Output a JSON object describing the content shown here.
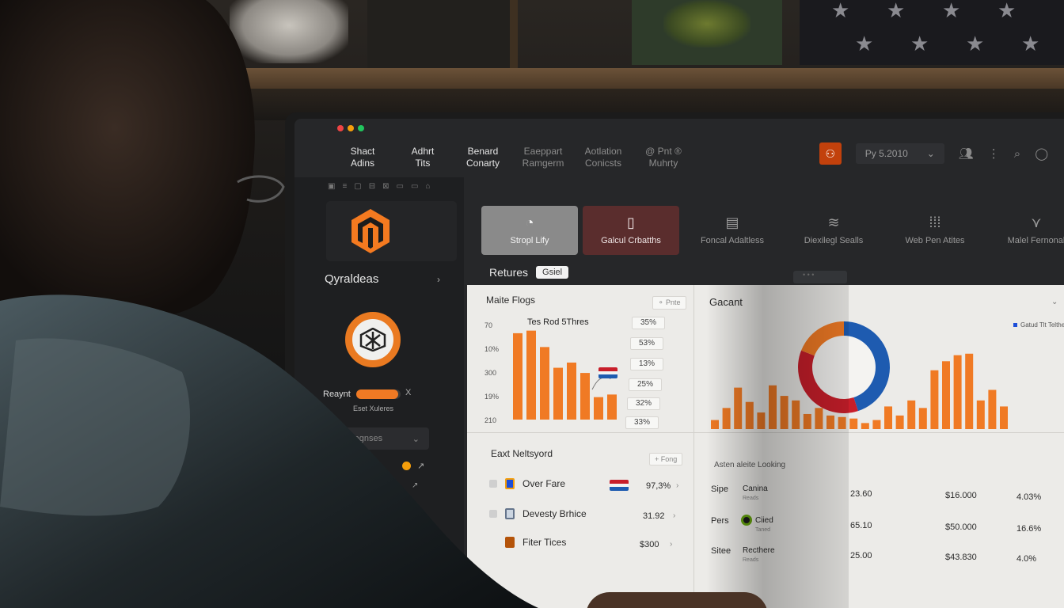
{
  "window": {
    "dots": [
      "#ef4444",
      "#f59e0b",
      "#22c55e"
    ]
  },
  "top_menu": [
    {
      "line1": "Shact",
      "line2": "Adins"
    },
    {
      "line1": "Adhrt",
      "line2": "Tits"
    },
    {
      "line1": "Benard",
      "line2": "Conarty"
    },
    {
      "line1": "Eaeppart",
      "line2": "Ramgerm"
    },
    {
      "line1": "Aotlation",
      "line2": "Conicsts"
    },
    {
      "line1": "@ Pnt ®",
      "line2": "Muhrty"
    }
  ],
  "top_right": {
    "select_text": "Py 5.2010",
    "select_chevron": "⌄"
  },
  "sidebar": {
    "heading": "Qyraldeas",
    "chevron": "›",
    "progress_label": "Reaynt",
    "progress_value": 0.95,
    "progress_x": "X",
    "progress_sub": "Eset Xuleres",
    "dropdown": "Oaster Viagnses",
    "dropdown_chevron": "⌄",
    "mini_arrow": "↗",
    "mini_arrow2": "↗"
  },
  "tabs": [
    {
      "icon": "◔",
      "label": "Stropl Lify"
    },
    {
      "icon": "▯",
      "label": "Galcul Crbatths"
    },
    {
      "icon": "▤",
      "label": "Foncal Adaltless"
    },
    {
      "icon": "≋",
      "label": "Diexilegl Sealls"
    },
    {
      "icon": "⁞⁞⁞",
      "label": "Web Pen Atites"
    },
    {
      "icon": "⋎",
      "label": "Malel Fernonal"
    }
  ],
  "returns": {
    "label": "Retures",
    "chip": "Gsiel"
  },
  "left_card": {
    "title": "Maite Flogs",
    "button": "⚬ Pnte",
    "chart_title": "Tes Rod 5Thres",
    "value_chips": [
      "35%",
      "53%",
      "13%",
      "25%",
      "32%",
      "33%"
    ]
  },
  "right_card": {
    "title": "Gacant",
    "chevron": "⌄",
    "legend": "Gatud Tlt Telthes"
  },
  "bottom_left": {
    "title": "Eaxt Neltsyord",
    "button": "+ Fong",
    "rows": [
      {
        "label": "Over Fare",
        "value": "97,3%",
        "arrow": "›"
      },
      {
        "label": "Devesty Brhice",
        "value": "31.92",
        "arrow": "›"
      },
      {
        "label": "Fiter Tices",
        "value": "$300",
        "arrow": "›"
      }
    ]
  },
  "bottom_right": {
    "title": "Asten aleite Looking",
    "rows": [
      {
        "key": "Sipe",
        "name": "Canina",
        "sub": "Reads",
        "v1": "23.60",
        "v2": "$16.000",
        "v3": "4.03%"
      },
      {
        "key": "Pers",
        "name": "Ciied",
        "sub": "Taned",
        "v1": "65.10",
        "v2": "$50.000",
        "v3": "16.6%"
      },
      {
        "key": "Sitee",
        "name": "Recthere",
        "sub": "Reads",
        "v1": "25.00",
        "v2": "$43.830",
        "v3": "4.0%"
      }
    ]
  },
  "chart_data": [
    {
      "type": "bar",
      "title": "Tes Rod 5Thres",
      "y_tick_labels": [
        "70",
        "10%",
        "300",
        "19%",
        "210"
      ],
      "values": [
        100,
        103,
        84,
        60,
        66,
        54,
        26,
        29
      ],
      "ylim": [
        0,
        110
      ],
      "color": "#f07a24"
    },
    {
      "type": "pie",
      "title": "Gacant",
      "slices": [
        {
          "value": 45,
          "color": "#1e5bb0"
        },
        {
          "value": 36,
          "color": "#c81e2a"
        },
        {
          "value": 19,
          "color": "#f07a24"
        }
      ]
    },
    {
      "type": "bar",
      "values": [
        12,
        28,
        55,
        36,
        22,
        58,
        44,
        38,
        20,
        28,
        18,
        16,
        14,
        8,
        12,
        30,
        18,
        38,
        28,
        78,
        90,
        98,
        100,
        38,
        52,
        30
      ],
      "ylim": [
        0,
        105
      ],
      "color": "#f07a24"
    }
  ]
}
